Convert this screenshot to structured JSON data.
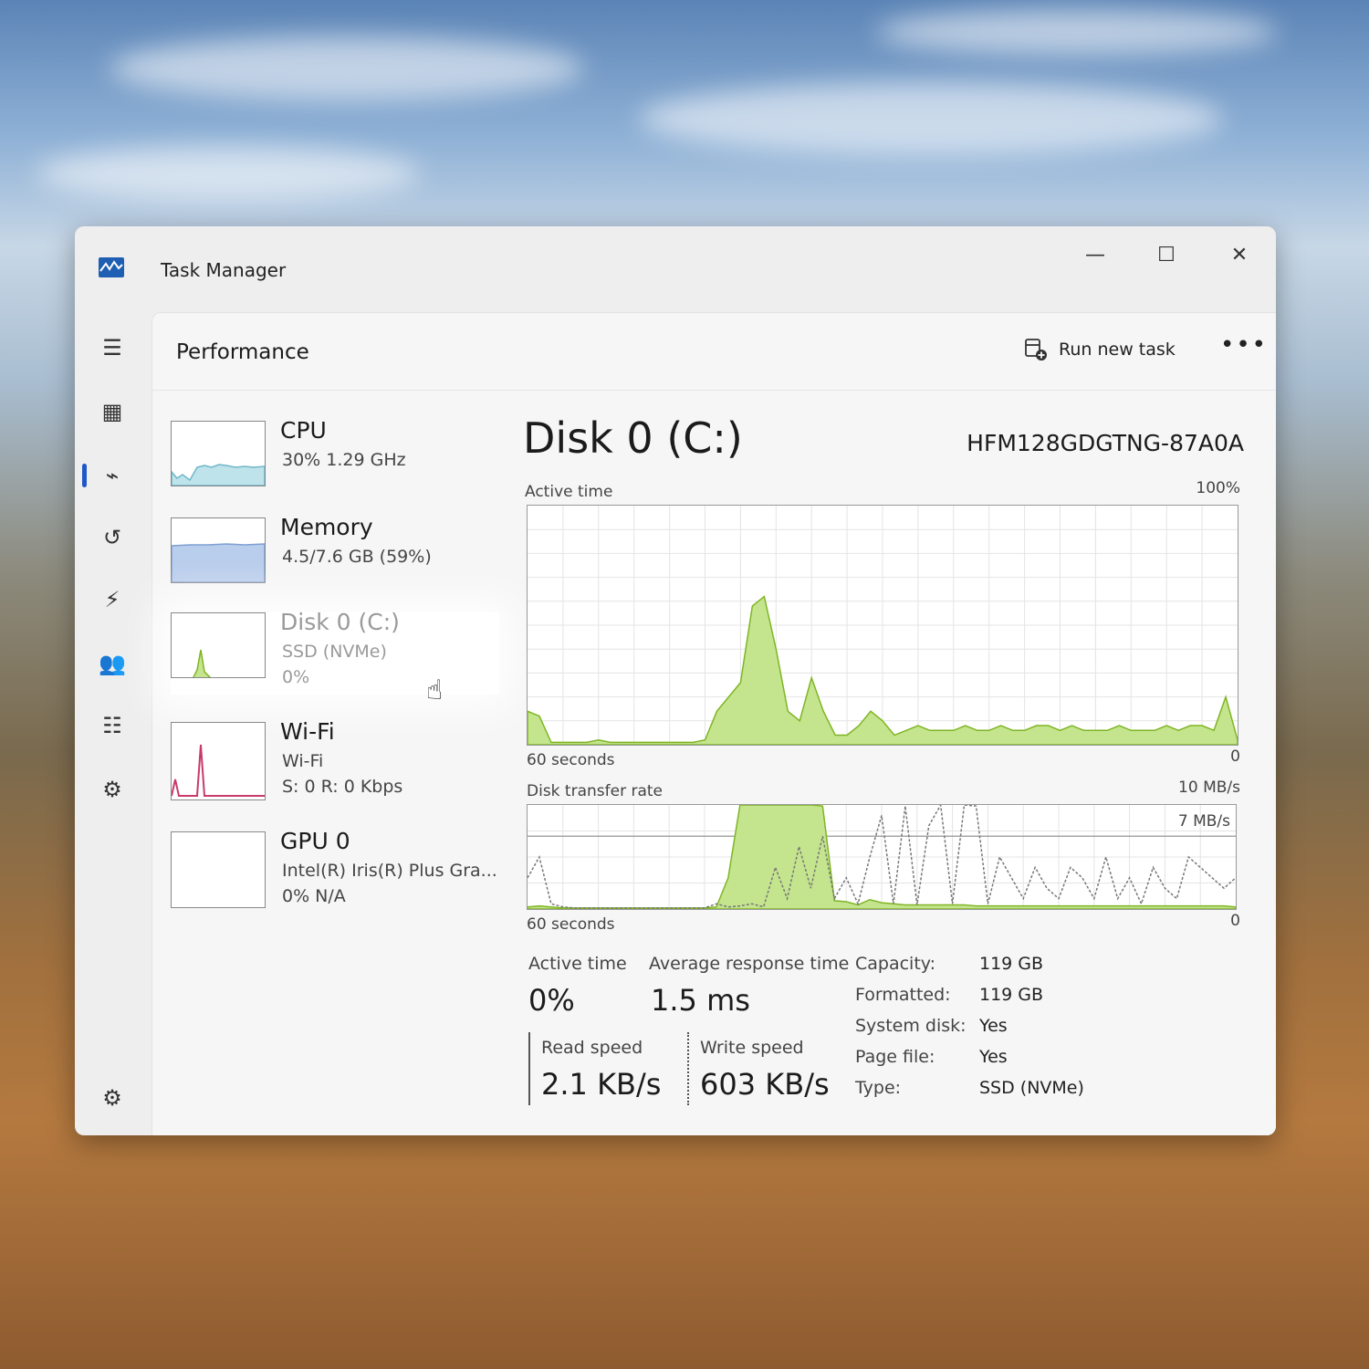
{
  "window": {
    "title": "Task Manager",
    "minimize": "—",
    "maximize": "☐",
    "close": "✕"
  },
  "nav": {
    "items": [
      {
        "name": "menu-icon",
        "glyph": "☰"
      },
      {
        "name": "processes-icon",
        "glyph": "▦"
      },
      {
        "name": "performance-icon",
        "glyph": "⌁"
      },
      {
        "name": "app-history-icon",
        "glyph": "↺"
      },
      {
        "name": "startup-apps-icon",
        "glyph": "⚡"
      },
      {
        "name": "users-icon",
        "glyph": "👥"
      },
      {
        "name": "details-icon",
        "glyph": "☷"
      },
      {
        "name": "services-icon",
        "glyph": "⚙"
      },
      {
        "name": "settings-icon",
        "glyph": "⚙"
      }
    ]
  },
  "header": {
    "title": "Performance",
    "run_new_task": "Run new task",
    "more": "•••"
  },
  "resources": [
    {
      "name": "CPU",
      "sub": "30%  1.29 GHz",
      "sub2": ""
    },
    {
      "name": "Memory",
      "sub": "4.5/7.6 GB (59%)",
      "sub2": ""
    },
    {
      "name": "Disk 0 (C:)",
      "sub": "SSD (NVMe)",
      "sub2": "0%"
    },
    {
      "name": "Wi-Fi",
      "sub": "Wi-Fi",
      "sub2": "S: 0  R: 0 Kbps"
    },
    {
      "name": "GPU 0",
      "sub": "Intel(R) Iris(R) Plus Gra...",
      "sub2": "0%  N/A"
    }
  ],
  "disk": {
    "title": "Disk 0 (C:)",
    "model": "HFM128GDGTNG-87A0A",
    "active_time_label": "Active time",
    "active_time_max": "100%",
    "active_time_left": "60 seconds",
    "active_time_right": "0",
    "transfer_label": "Disk transfer rate",
    "transfer_max": "10 MB/s",
    "transfer_mid": "7 MB/s",
    "transfer_left": "60 seconds",
    "transfer_right": "0"
  },
  "stats": {
    "active_time_h": "Active time",
    "active_time_v": "0%",
    "avg_resp_h": "Average response time",
    "avg_resp_v": "1.5 ms",
    "read_h": "Read speed",
    "read_v": "2.1 KB/s",
    "write_h": "Write speed",
    "write_v": "603 KB/s"
  },
  "props": [
    {
      "k": "Capacity:",
      "v": "119 GB"
    },
    {
      "k": "Formatted:",
      "v": "119 GB"
    },
    {
      "k": "System disk:",
      "v": "Yes"
    },
    {
      "k": "Page file:",
      "v": "Yes"
    },
    {
      "k": "Type:",
      "v": "SSD (NVMe)"
    }
  ],
  "colors": {
    "disk_fill": "#c4e58e",
    "disk_line": "#7fb524",
    "cpu": "#6fb7c9",
    "memory": "#8fb0dc",
    "wifi": "#c93a6c",
    "accent": "#1f56c9"
  },
  "chart_data": [
    {
      "type": "area",
      "title": "Active time",
      "ylim": [
        0,
        100
      ],
      "x": [
        60,
        59,
        58,
        57,
        56,
        55,
        54,
        53,
        52,
        51,
        50,
        49,
        48,
        47,
        46,
        45,
        44,
        43,
        42,
        41,
        40,
        39,
        38,
        37,
        36,
        35,
        34,
        33,
        32,
        31,
        30,
        29,
        28,
        27,
        26,
        25,
        24,
        23,
        22,
        21,
        20,
        19,
        18,
        17,
        16,
        15,
        14,
        13,
        12,
        11,
        10,
        9,
        8,
        7,
        6,
        5,
        4,
        3,
        2,
        1,
        0
      ],
      "series": [
        {
          "values": [
            14,
            12,
            1,
            1,
            1,
            1,
            2,
            1,
            1,
            1,
            1,
            1,
            1,
            1,
            1,
            2,
            14,
            20,
            26,
            58,
            62,
            40,
            14,
            10,
            28,
            14,
            4,
            4,
            8,
            14,
            10,
            4,
            6,
            8,
            6,
            6,
            6,
            8,
            6,
            6,
            8,
            6,
            6,
            8,
            8,
            6,
            8,
            6,
            6,
            6,
            8,
            6,
            6,
            6,
            8,
            6,
            8,
            8,
            6,
            20,
            2
          ]
        }
      ]
    },
    {
      "type": "area",
      "title": "Disk transfer rate",
      "ylim": [
        0,
        10
      ],
      "x": [
        60,
        59,
        58,
        57,
        56,
        55,
        54,
        53,
        52,
        51,
        50,
        49,
        48,
        47,
        46,
        45,
        44,
        43,
        42,
        41,
        40,
        39,
        38,
        37,
        36,
        35,
        34,
        33,
        32,
        31,
        30,
        29,
        28,
        27,
        26,
        25,
        24,
        23,
        22,
        21,
        20,
        19,
        18,
        17,
        16,
        15,
        14,
        13,
        12,
        11,
        10,
        9,
        8,
        7,
        6,
        5,
        4,
        3,
        2,
        1,
        0
      ],
      "series": [
        {
          "values": [
            0.2,
            0.3,
            0.2,
            0.1,
            0.1,
            0.1,
            0.1,
            0.1,
            0.1,
            0.1,
            0.1,
            0.1,
            0.1,
            0.1,
            0.1,
            0.1,
            0.2,
            3,
            10,
            10,
            10,
            10,
            10,
            10,
            10,
            9.9,
            0.8,
            0.7,
            0.4,
            0.9,
            0.6,
            0.5,
            0.4,
            0.4,
            0.4,
            0.4,
            0.4,
            0.4,
            0.3,
            0.3,
            0.3,
            0.3,
            0.3,
            0.3,
            0.3,
            0.3,
            0.3,
            0.3,
            0.3,
            0.3,
            0.3,
            0.3,
            0.3,
            0.3,
            0.3,
            0.3,
            0.3,
            0.3,
            0.3,
            0.3,
            0.2
          ]
        },
        {
          "values": [
            3,
            5,
            0.5,
            0.2,
            0.1,
            0.1,
            0.1,
            0.1,
            0.1,
            0.1,
            0.1,
            0.1,
            0.1,
            0.1,
            0.1,
            0.1,
            0.5,
            0.2,
            0.3,
            0.5,
            0.2,
            4,
            1,
            6,
            2,
            7,
            1,
            3,
            0.5,
            5,
            9,
            0.5,
            9.9,
            0.4,
            8,
            10,
            0.5,
            10,
            9.9,
            0.5,
            5,
            3,
            1,
            4,
            2,
            1,
            4,
            3,
            1,
            5,
            1,
            3,
            0.5,
            4,
            2,
            1,
            5,
            4,
            3,
            2,
            3
          ]
        }
      ]
    }
  ]
}
